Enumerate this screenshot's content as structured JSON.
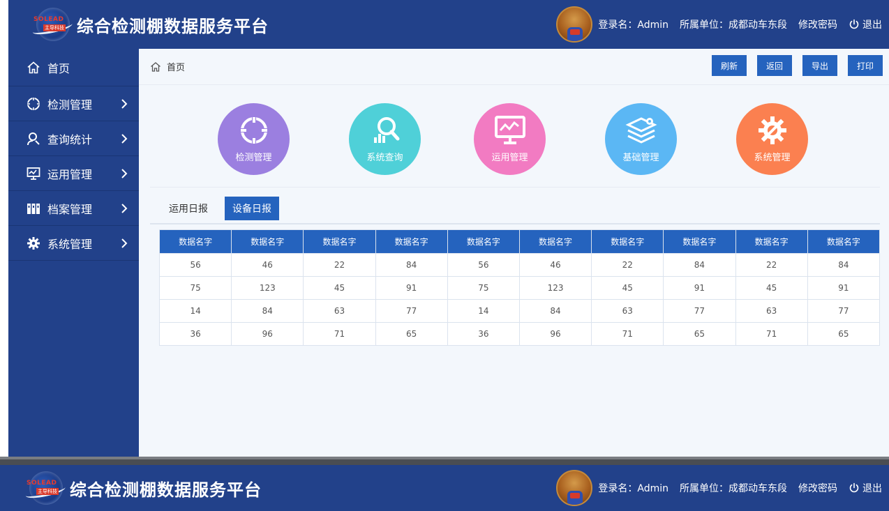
{
  "app": {
    "title": "综合检测棚数据服务平台",
    "logo_text_top": "SOLEAD",
    "logo_text_bottom": "主导科技"
  },
  "header": {
    "login_label": "登录名：Admin",
    "unit_label": "所属单位：成都动车东段",
    "change_password": "修改密码",
    "logout": "退出"
  },
  "sidebar": {
    "items": [
      {
        "label": "首页",
        "icon": "home-icon"
      },
      {
        "label": "检测管理",
        "icon": "crosshair-icon"
      },
      {
        "label": "查询统计",
        "icon": "search-person-icon"
      },
      {
        "label": "运用管理",
        "icon": "monitor-chart-icon"
      },
      {
        "label": "档案管理",
        "icon": "binders-icon"
      },
      {
        "label": "系统管理",
        "icon": "gear-icon"
      }
    ]
  },
  "breadcrumb": {
    "label": "首页"
  },
  "toolbar": {
    "refresh": "刷新",
    "back": "返回",
    "export": "导出",
    "print": "打印"
  },
  "tiles": [
    {
      "label": "检测管理",
      "color": "#9b7fe0",
      "icon": "crosshair-icon"
    },
    {
      "label": "系统查询",
      "color": "#4fd0d8",
      "icon": "search-chart-icon"
    },
    {
      "label": "运用管理",
      "color": "#f27bc2",
      "icon": "monitor-chart-icon"
    },
    {
      "label": "基础管理",
      "color": "#5bb7f4",
      "icon": "layers-gear-icon"
    },
    {
      "label": "系统管理",
      "color": "#fb8050",
      "icon": "gear-wrench-icon"
    }
  ],
  "tabs": [
    {
      "label": "运用日报",
      "active": false
    },
    {
      "label": "设备日报",
      "active": true
    }
  ],
  "table": {
    "headers": [
      "数据名字",
      "数据名字",
      "数据名字",
      "数据名字",
      "数据名字",
      "数据名字",
      "数据名字",
      "数据名字",
      "数据名字",
      "数据名字"
    ],
    "rows": [
      [
        "56",
        "46",
        "22",
        "84",
        "56",
        "46",
        "22",
        "84",
        "22",
        "84"
      ],
      [
        "75",
        "123",
        "45",
        "91",
        "75",
        "123",
        "45",
        "91",
        "45",
        "91"
      ],
      [
        "14",
        "84",
        "63",
        "77",
        "14",
        "84",
        "63",
        "77",
        "63",
        "77"
      ],
      [
        "36",
        "96",
        "71",
        "65",
        "36",
        "96",
        "71",
        "65",
        "71",
        "65"
      ]
    ]
  },
  "colors": {
    "header_bg": "#22418a",
    "accent_blue": "#2563be",
    "page_bg": "#f3f7fc"
  }
}
